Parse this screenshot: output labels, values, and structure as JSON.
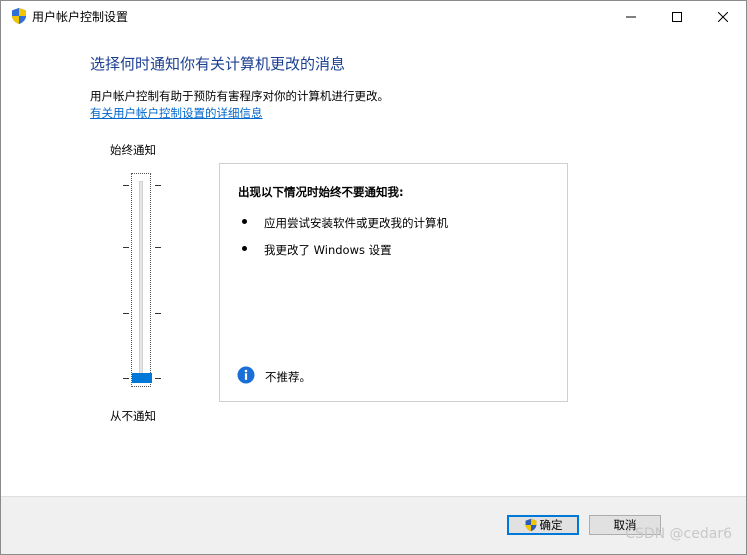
{
  "window": {
    "title": "用户帐户控制设置",
    "icon": "uac-shield-icon",
    "controls": {
      "minimize": "minimize-icon",
      "maximize": "maximize-icon",
      "close": "close-icon"
    }
  },
  "content": {
    "heading": "选择何时通知你有关计算机更改的消息",
    "description": "用户帐户控制有助于预防有害程序对你的计算机进行更改。",
    "link": "有关用户帐户控制设置的详细信息"
  },
  "slider": {
    "top_label": "始终通知",
    "bottom_label": "从不通知",
    "levels": 4,
    "selected_level": 1
  },
  "panel": {
    "title": "出现以下情况时始终不要通知我:",
    "bullets": [
      "应用尝试安装软件或更改我的计算机",
      "我更改了 Windows 设置"
    ],
    "note_icon": "info-icon",
    "note": "不推荐。"
  },
  "footer": {
    "ok_label": "确定",
    "cancel_label": "取消",
    "watermark": "CSDN @cedar6"
  },
  "colors": {
    "heading": "#1b3f91",
    "link": "#0066cc",
    "accent": "#0078d7"
  }
}
